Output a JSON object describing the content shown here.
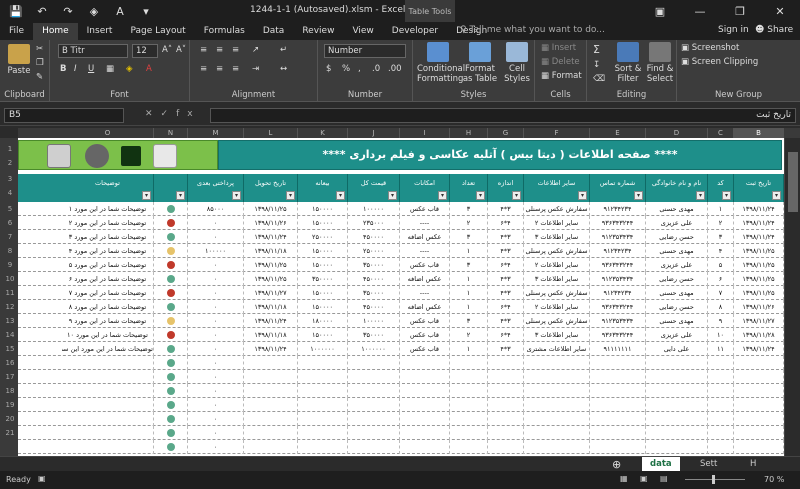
{
  "titlebar": {
    "doc_title": "1244-1-1 (Autosaved).xlsm - Excel",
    "context_tab": "Table Tools",
    "qat": [
      "save-icon",
      "undo-icon",
      "redo-icon",
      "paint-bucket-icon",
      "font-color-icon",
      "customize-icon"
    ]
  },
  "tabs": [
    "File",
    "Home",
    "Insert",
    "Page Layout",
    "Formulas",
    "Data",
    "Review",
    "View",
    "Developer",
    "Design"
  ],
  "active_tab": "Home",
  "tell_me": "Tell me what you want to do...",
  "sign_in": "Sign in",
  "share": "Share",
  "ribbon": {
    "clipboard": {
      "paste": "Paste",
      "label": "Clipboard"
    },
    "font": {
      "name": "B Titr",
      "size": "12",
      "label": "Font"
    },
    "alignment": {
      "label": "Alignment"
    },
    "number": {
      "format": "Number",
      "label": "Number"
    },
    "styles": {
      "cond": "Conditional Formatting",
      "table": "Format as Table",
      "cell": "Cell Styles",
      "label": "Styles"
    },
    "cells": {
      "insert": "Insert",
      "delete": "Delete",
      "format": "Format",
      "label": "Cells"
    },
    "editing": {
      "sort": "Sort & Filter",
      "find": "Find & Select",
      "label": "Editing"
    },
    "newgroup": {
      "screenshot": "Screenshot",
      "clipping": "Screen Clipping",
      "label": "New Group"
    }
  },
  "formula_bar": {
    "name_box": "B5",
    "content": "تاریخ ثبت"
  },
  "columns": [
    {
      "letter": "B",
      "sel": true
    },
    {
      "letter": "C"
    },
    {
      "letter": "D"
    },
    {
      "letter": "E"
    },
    {
      "letter": "F"
    },
    {
      "letter": "G"
    },
    {
      "letter": "H"
    },
    {
      "letter": "I"
    },
    {
      "letter": "J"
    },
    {
      "letter": "K"
    },
    {
      "letter": "L"
    },
    {
      "letter": "M"
    },
    {
      "letter": "N"
    },
    {
      "letter": "O"
    }
  ],
  "banner_title": "****  صفحه اطلاعات ( دیتا بیس ) آتلیه عکاسی و فیلم برداری  ****",
  "headers": [
    "تاریخ ثبت",
    "کد",
    "نام و نام خانوادگی",
    "شماره تماس",
    "سایر اطلاعات",
    "اندازه",
    "تعداد",
    "امکانات",
    "قیمت کل",
    "بیعانه",
    "تاریخ تحویل",
    "پرداختی بعدی",
    "مانده حساب",
    "",
    "توضیحات"
  ],
  "rows": [
    [
      "۱۳۹۸/۱۱/۲۴",
      "۱",
      "مهدی حسنی",
      "۹۱۲۳۴۲۳۴",
      "سفارش عکس پرسنلی",
      "۳*۴",
      "۳",
      "قاب عکس",
      "۱۰۰۰۰۰",
      "۱۵۰۰۰۰",
      "۱۳۹۸/۱۱/۲۵",
      "۸۵۰۰۰",
      "۰",
      "g",
      "توضیحات شما در این مورد ۱"
    ],
    [
      "۱۳۹۸/۱۱/۲۴",
      "۲",
      "علی عزیزی",
      "۹۳۶۳۴۳۲۴۴",
      "سایر اطلاعات ۲",
      "۴*۶",
      "۲",
      "----",
      "۲۳۵۰۰۰",
      "۱۵۰۰۰۰",
      "۱۳۹۸/۱۱/۲۶",
      "۰",
      "۱۹۵۰۰۰",
      "r",
      "توضیحات شما در این مورد ۲"
    ],
    [
      "۱۳۹۸/۱۱/۲۴",
      "۳",
      "حسن رضایی",
      "۹۱۲۳۵۳۴۳۴",
      "سایر اطلاعات ۳",
      "۳*۴",
      "۳",
      "عکس اضافه",
      "۴۵۰۰۰۰",
      "۲۵۰۰۰۰",
      "۱۳۹۸/۱۱/۲۴",
      "۰",
      "۰",
      "g",
      "توضیحات شما در این مورد ۳"
    ],
    [
      "۱۳۹۸/۱۱/۲۵",
      "۴",
      "مهدی حسنی",
      "۹۱۲۳۴۲۳۴",
      "سفارش عکس پرسنلی",
      "۳*۴",
      "۱",
      "----",
      "۲۵۰۰۰۰",
      "۱۵۰۰۰۰",
      "۱۳۹۸/۱۱/۱۸",
      "۱۰۰۰۰۰",
      "۱۵۰۰۰۰",
      "y",
      "توضیحات شما در این مورد ۴"
    ],
    [
      "۱۳۹۸/۱۱/۲۵",
      "۵",
      "علی عزیزی",
      "۹۳۶۳۴۳۲۴۴",
      "سایر اطلاعات ۲",
      "۴*۶",
      "۳",
      "قاب عکس",
      "۳۵۰۰۰۰",
      "۱۵۰۰۰۰",
      "۱۳۹۸/۱۱/۲۵",
      "۰",
      "۱۹۵۰۰۰",
      "r",
      "توضیحات شما در این مورد ۵"
    ],
    [
      "۱۳۹۸/۱۱/۲۵",
      "۶",
      "حسن رضایی",
      "۹۱۲۳۵۳۴۳۴",
      "سایر اطلاعات ۳",
      "۳*۴",
      "۱",
      "عکس اضافه",
      "۴۵۰۰۰۰",
      "۳۵۰۰۰۰",
      "۱۳۹۸/۱۱/۲۵",
      "۰",
      "۰",
      "g",
      "توضیحات شما در این مورد ۶"
    ],
    [
      "۱۳۹۸/۱۱/۲۵",
      "۷",
      "مهدی حسنی",
      "۹۱۲۳۴۲۳۴",
      "سفارش عکس پرسنلی",
      "۳*۴",
      "۱",
      "----",
      "۳۵۰۰۰۰",
      "۱۵۰۰۰۰",
      "۱۳۹۸/۱۱/۲۷",
      "۰",
      "۲۰۰۰۰۰",
      "r",
      "توضیحات شما در این مورد ۷"
    ],
    [
      "۱۳۹۸/۱۱/۲۶",
      "۸",
      "حسن رضایی",
      "۹۳۶۳۴۳۲۴۴",
      "سایر اطلاعات ۲",
      "۴*۶",
      "۱",
      "عکس اضافه",
      "۴۵۰۰۰۰",
      "۱۵۰۰۰۰",
      "۱۳۹۸/۱۱/۱۸",
      "۰",
      "۰",
      "g",
      "توضیحات شما در این مورد ۸"
    ],
    [
      "۱۳۹۸/۱۱/۲۷",
      "۹",
      "مهدی حسنی",
      "۹۱۲۳۵۳۴۳۴",
      "سفارش عکس پرسنلی",
      "۳*۴",
      "۳",
      "قاب عکس",
      "۱۰۰۰۰۰",
      "۱۸۰۰۰۰",
      "۱۳۹۸/۱۱/۲۴",
      "۰",
      "۰",
      "y",
      "توضیحات شما در این مورد ۹"
    ],
    [
      "۱۳۹۸/۱۱/۲۸",
      "۱۰",
      "علی عزیزی",
      "۹۳۶۳۴۳۲۴۴",
      "سایر اطلاعات ۳",
      "۴*۶",
      "۲",
      "قاب عکس",
      "۳۵۰۰۰۰",
      "۱۵۰۰۰۰",
      "۱۳۹۸/۱۱/۱۸",
      "۰",
      "۲۰۰۰۰۰",
      "r",
      "توضیحات شما در این مورد ۱۰"
    ],
    [
      "۱۳۹۸/۱۱/۲۴",
      "۱۱",
      "علی دایی",
      "۹۱۱۱۱۱۱۱",
      "سایر اطلاعات مشتری",
      "۳*۴",
      "۱",
      "قاب عکس",
      "۱۰۰۰۰۰۰",
      "۱۰۰۰۰۰۰",
      "۱۳۹۸/۱۱/۲۴",
      "۰",
      "۰",
      "g",
      "توضیحات شما در این مورد این سفارش"
    ]
  ],
  "empty_rows": 7,
  "sheet_tabs": [
    "data",
    "Sett",
    "H"
  ],
  "active_sheet": "data",
  "status": {
    "ready": "Ready",
    "zoom": "70 %"
  },
  "colors": {
    "teal": "#1e8f8a",
    "green": "#7cc04a",
    "dot_green": "#5aa88a",
    "dot_red": "#c0392b",
    "dot_yellow": "#e6c36a"
  }
}
